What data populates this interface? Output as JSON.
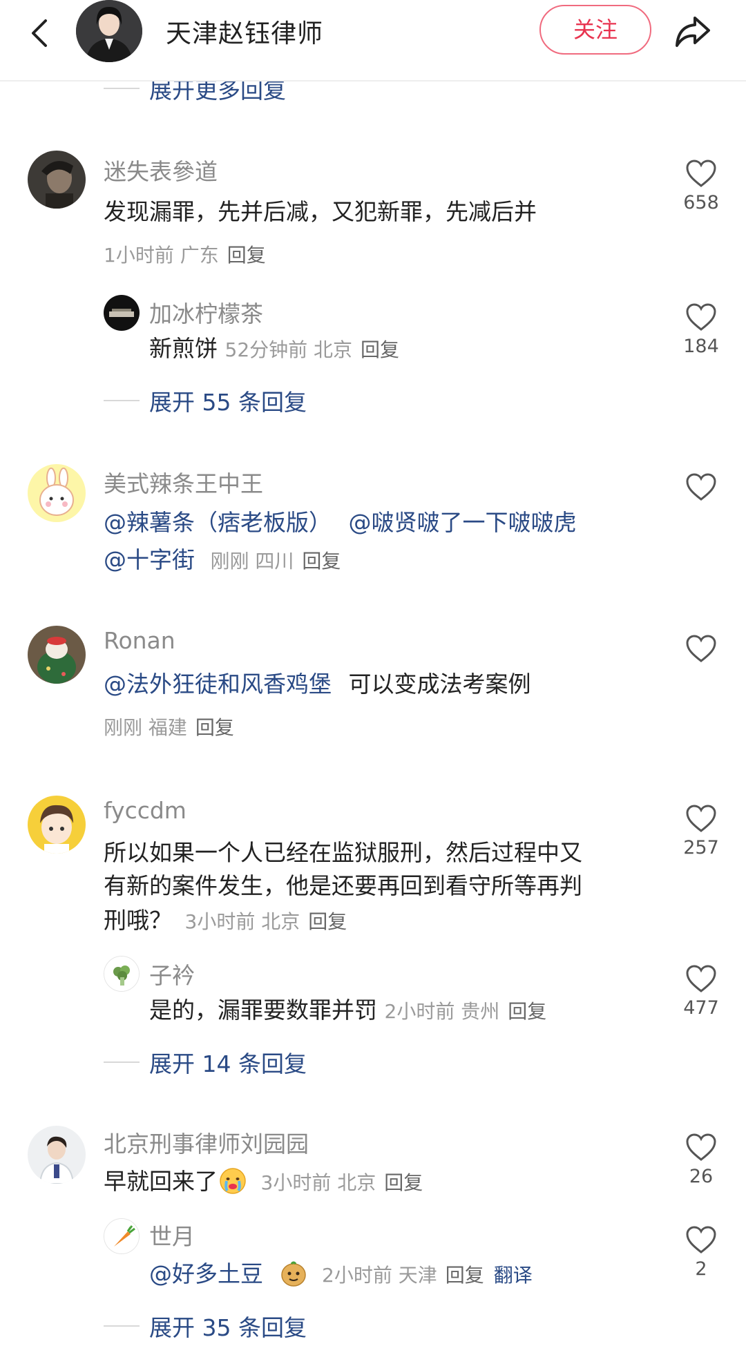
{
  "header": {
    "title": "天津赵钰律师",
    "follow_label": "关注"
  },
  "top_expand": "展开更多回复",
  "comments": [
    {
      "user": "迷失表參道",
      "text": "发现漏罪，先并后减，又犯新罪，先减后并",
      "meta": "1小时前 广东",
      "reply": "回复",
      "likes": "658",
      "sub": {
        "user": "加冰柠檬茶",
        "text": "新煎饼",
        "meta": "52分钟前 北京",
        "reply": "回复",
        "likes": "184"
      },
      "expand": "展开 55 条回复"
    },
    {
      "user": "美式辣条王中王",
      "mention1": "@辣薯条（痞老板版）",
      "mention2": "@啵贤啵了一下啵啵虎",
      "mention3": "@十字街",
      "meta": "刚刚 四川",
      "reply": "回复"
    },
    {
      "user": "Ronan",
      "mention": "@法外狂徒和风香鸡堡",
      "text": "可以变成法考案例",
      "meta": "刚刚 福建",
      "reply": "回复"
    },
    {
      "user": "fyccdm",
      "line1": "所以如果一个人已经在监狱服刑，然后过程中又",
      "line2": "有新的案件发生，他是还要再回到看守所等再判",
      "line3": "刑哦？",
      "meta": "3小时前 北京",
      "reply": "回复",
      "likes": "257",
      "sub": {
        "user": "子衿",
        "text": "是的，漏罪要数罪并罚",
        "meta": "2小时前 贵州",
        "reply": "回复",
        "likes": "477"
      },
      "expand": "展开 14 条回复"
    },
    {
      "user": "北京刑事律师刘园园",
      "text": "早就回来了",
      "meta": "3小时前 北京",
      "reply": "回复",
      "likes": "26",
      "sub": {
        "user": "世月",
        "mention": "@好多土豆",
        "meta": "2小时前 天津",
        "reply": "回复",
        "translate": "翻译",
        "likes": "2"
      },
      "expand": "展开 35 条回复"
    }
  ],
  "colors": {
    "accent_red": "#e8334f",
    "mention_blue": "#2a4a85",
    "meta_gray": "#9a9a9a"
  }
}
